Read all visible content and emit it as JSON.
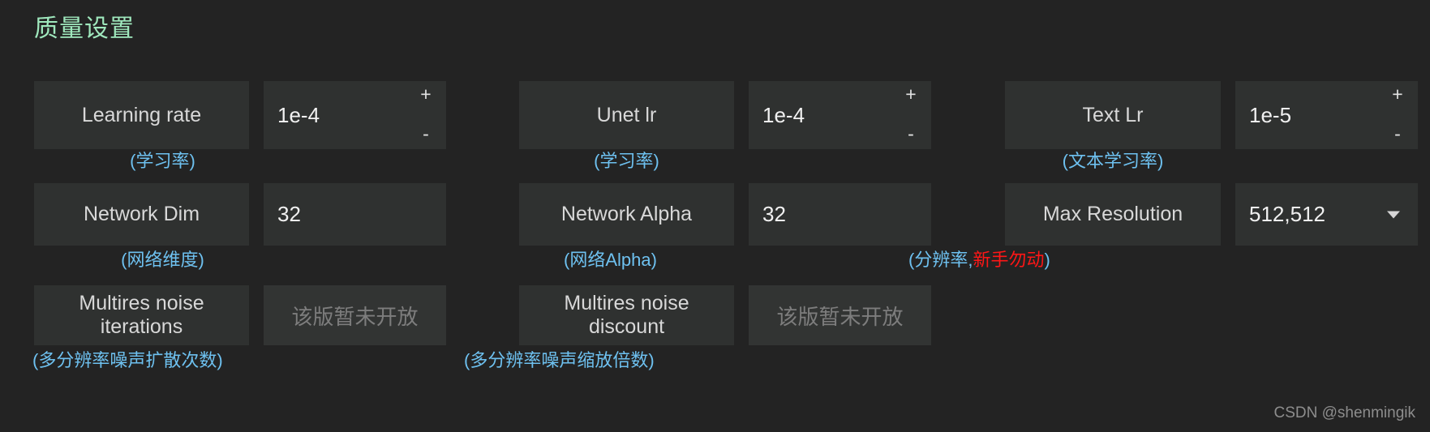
{
  "page": {
    "title": "质量设置",
    "background_color": "#232323",
    "title_color": "#9fe8bd",
    "hint_color": "#6ec1f0",
    "warn_color": "#ff1616",
    "watermark": "CSDN @shenmingik"
  },
  "columns": [
    {
      "fields": [
        {
          "label": "Learning rate",
          "value": "1e-4",
          "control": "number-stepper",
          "plus": "+",
          "minus": "-",
          "hint": "(学习率)",
          "hint_warn": ""
        },
        {
          "label": "Network Dim",
          "value": "32",
          "control": "text",
          "hint": "(网络维度)",
          "hint_warn": ""
        },
        {
          "label": "Multires noise iterations",
          "value": "该版暂未开放",
          "control": "disabled",
          "hint": "(多分辨率噪声扩散次数)",
          "hint_warn": ""
        }
      ]
    },
    {
      "fields": [
        {
          "label": "Unet lr",
          "value": "1e-4",
          "control": "number-stepper",
          "plus": "+",
          "minus": "-",
          "hint": "(学习率)",
          "hint_warn": ""
        },
        {
          "label": "Network Alpha",
          "value": "32",
          "control": "text",
          "hint": "(网络Alpha)",
          "hint_warn": ""
        },
        {
          "label": "Multires noise discount",
          "value": "该版暂未开放",
          "control": "disabled",
          "hint": "(多分辨率噪声缩放倍数)",
          "hint_warn": ""
        }
      ]
    },
    {
      "fields": [
        {
          "label": "Text Lr",
          "value": "1e-5",
          "control": "number-stepper",
          "plus": "+",
          "minus": "-",
          "hint": "(文本学习率)",
          "hint_warn": ""
        },
        {
          "label": "Max Resolution",
          "value": "512,512",
          "control": "dropdown",
          "hint_prefix": "(分辨率,",
          "hint_warn": "新手勿动",
          "hint_suffix": ")"
        }
      ]
    }
  ]
}
